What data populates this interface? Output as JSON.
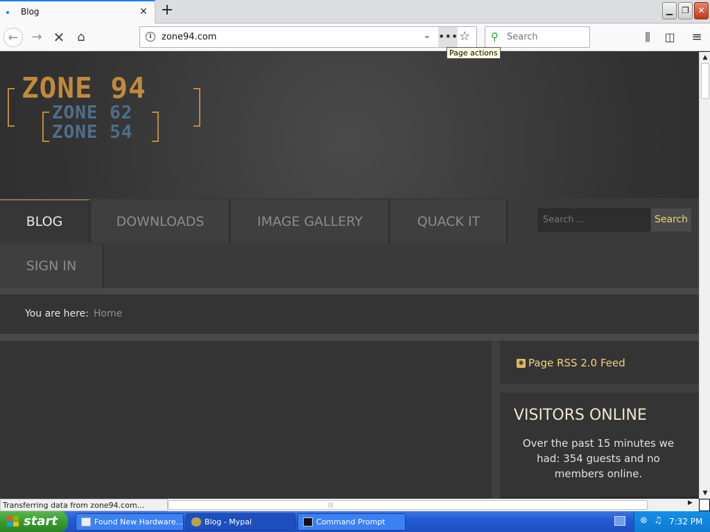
{
  "browser": {
    "tab": {
      "title": "Blog"
    },
    "address_bar": {
      "url": "zone94.com"
    },
    "tooltip": "Page actions",
    "search": {
      "placeholder": "Search"
    },
    "status_text": "Transferring data from zone94.com..."
  },
  "site": {
    "logo": {
      "line1": "ZONE 94",
      "line2": "ZONE 62",
      "line3": "ZONE 54"
    },
    "menu": [
      {
        "label": "BLOG",
        "active": true
      },
      {
        "label": "DOWNLOADS",
        "active": false
      },
      {
        "label": "IMAGE GALLERY",
        "active": false
      },
      {
        "label": "QUACK IT",
        "active": false
      },
      {
        "label": "SIGN IN",
        "active": false
      }
    ],
    "search": {
      "placeholder": "Search ...",
      "button": "Search"
    },
    "breadcrumb": {
      "label": "You are here:",
      "home": "Home"
    },
    "sidebar": {
      "rss": "Page RSS 2.0 Feed",
      "visitors_title": "VISITORS ONLINE",
      "visitors_text": "Over the past 15 minutes we had: 354 guests and no members online."
    }
  },
  "taskbar": {
    "start": "start",
    "tasks": [
      {
        "label": "Found New Hardware...",
        "active": false
      },
      {
        "label": "Blog - Mypal",
        "active": true
      },
      {
        "label": "Command Prompt",
        "active": false
      }
    ],
    "clock": "7:32 PM"
  },
  "colors": {
    "accent": "#f2d27c",
    "logo_gold": "#c08a3e",
    "logo_blue": "#4d6f8a",
    "page_bg": "#343434"
  }
}
